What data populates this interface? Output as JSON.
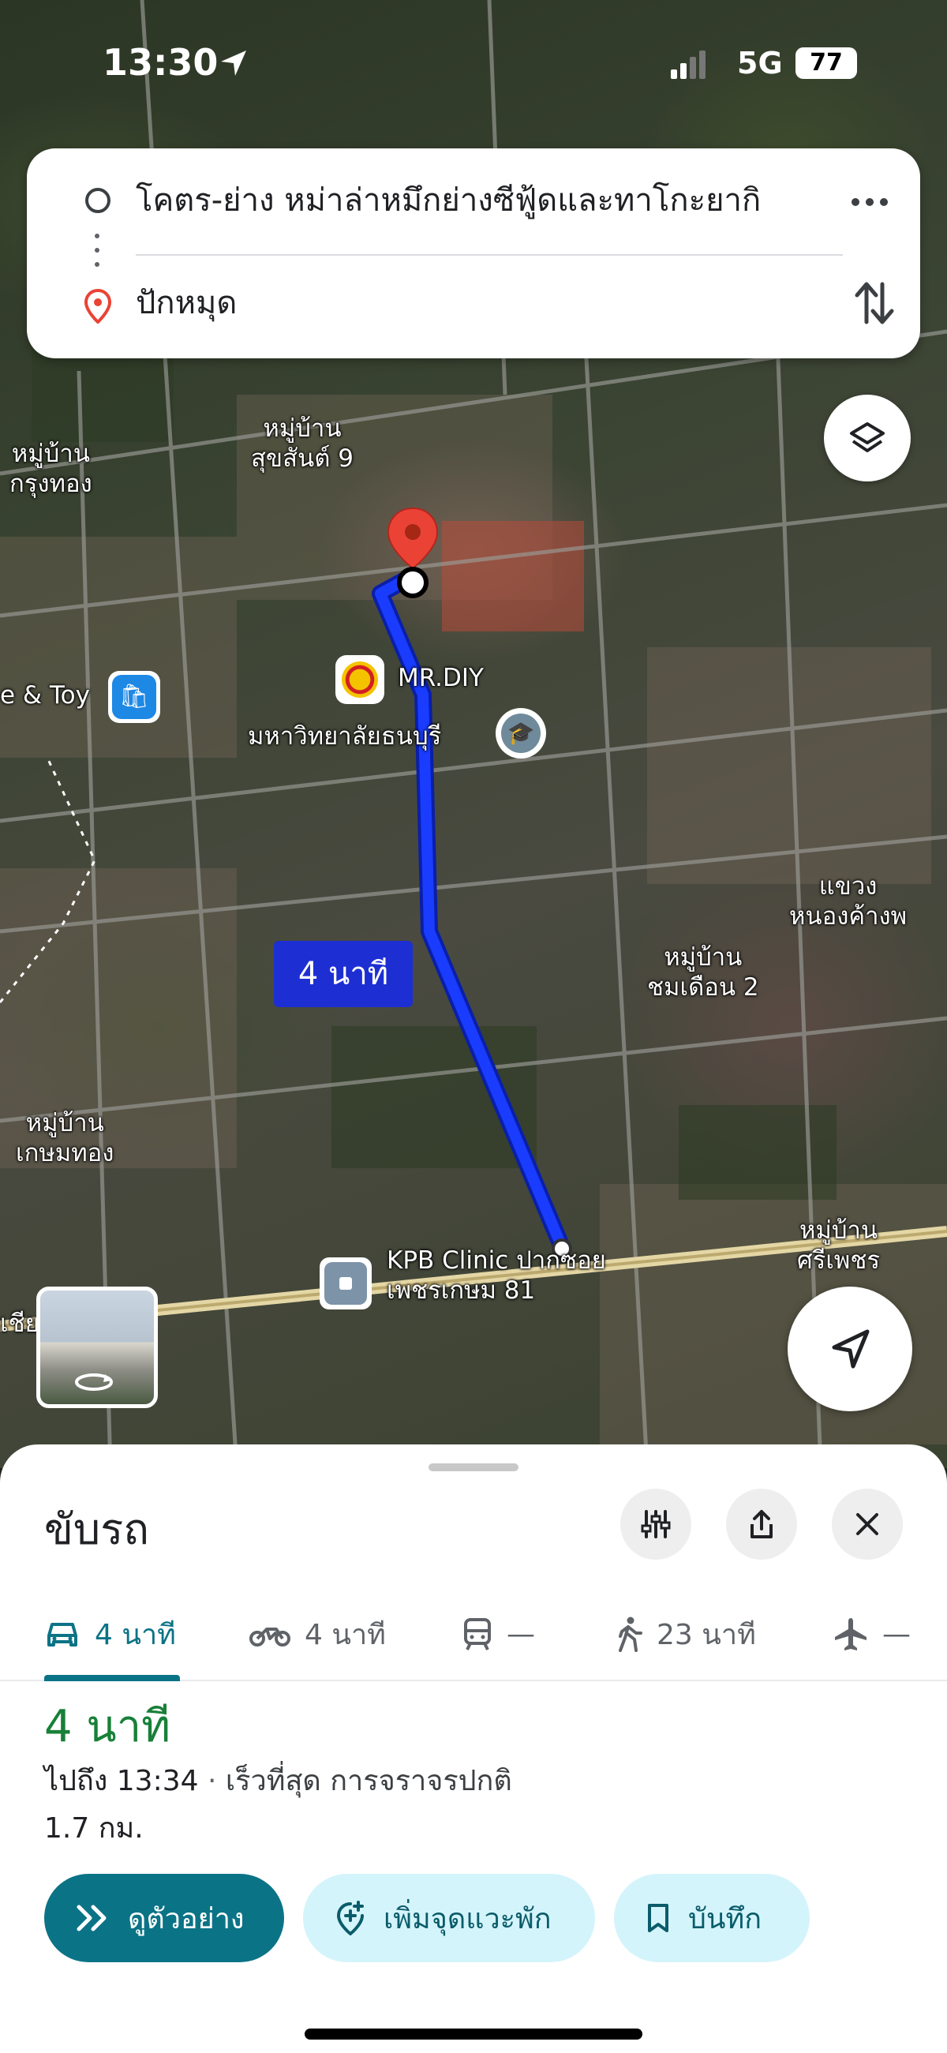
{
  "status_bar": {
    "time": "13:30",
    "network": "5G",
    "battery": "77"
  },
  "search": {
    "origin": "โคตร-ย่าง หม่าล่าหมึกย่างซีฟู้ดและทาโกะยากิ",
    "destination": "ปักหมุด"
  },
  "map": {
    "route_duration_label": "4 นาที",
    "labels": {
      "village_suksan": "หมู่บ้าน\nสุขสันต์ 9",
      "village_krungthong": "หมู่บ้าน\nกรุงทอง",
      "toy_store": "e & Toy",
      "mrdiy": "MR.DIY",
      "university": "มหาวิทยาลัยธนบุรี",
      "district": "แขวง\nหนองค้างพ",
      "village_chomduean": "หมู่บ้าน\nชมเดือน 2",
      "village_kasemthong": "หมู่บ้าน\nเกษมทอง",
      "clinic": "KPB Clinic ปากซอย\nเพชรเกษม 81",
      "village_sriphet": "หมู่บ้าน\nศรีเพชร",
      "left_edge": "เชีย"
    },
    "route_color": "#1a3cff",
    "pin_color": "#ea4335"
  },
  "sheet": {
    "title": "ขับรถ",
    "modes": [
      {
        "name": "car",
        "label": "4 นาที",
        "active": true
      },
      {
        "name": "motorcycle",
        "label": "4 นาที",
        "active": false
      },
      {
        "name": "transit",
        "label": "—",
        "active": false
      },
      {
        "name": "walk",
        "label": "23 นาที",
        "active": false
      },
      {
        "name": "flight",
        "label": "—",
        "active": false
      }
    ],
    "duration": "4 นาที",
    "arrival_prefix": "ไปถึง 13:34",
    "arrival_sep": " · ",
    "arrival_detail": "เร็วที่สุด การจราจรปกติ",
    "distance": "1.7 กม.",
    "buttons": {
      "preview": "ดูตัวอย่าง",
      "add_stop": "เพิ่มจุดแวะพัก",
      "save": "บันทึก"
    },
    "accent_color": "#0b7386",
    "duration_color": "#188038"
  }
}
